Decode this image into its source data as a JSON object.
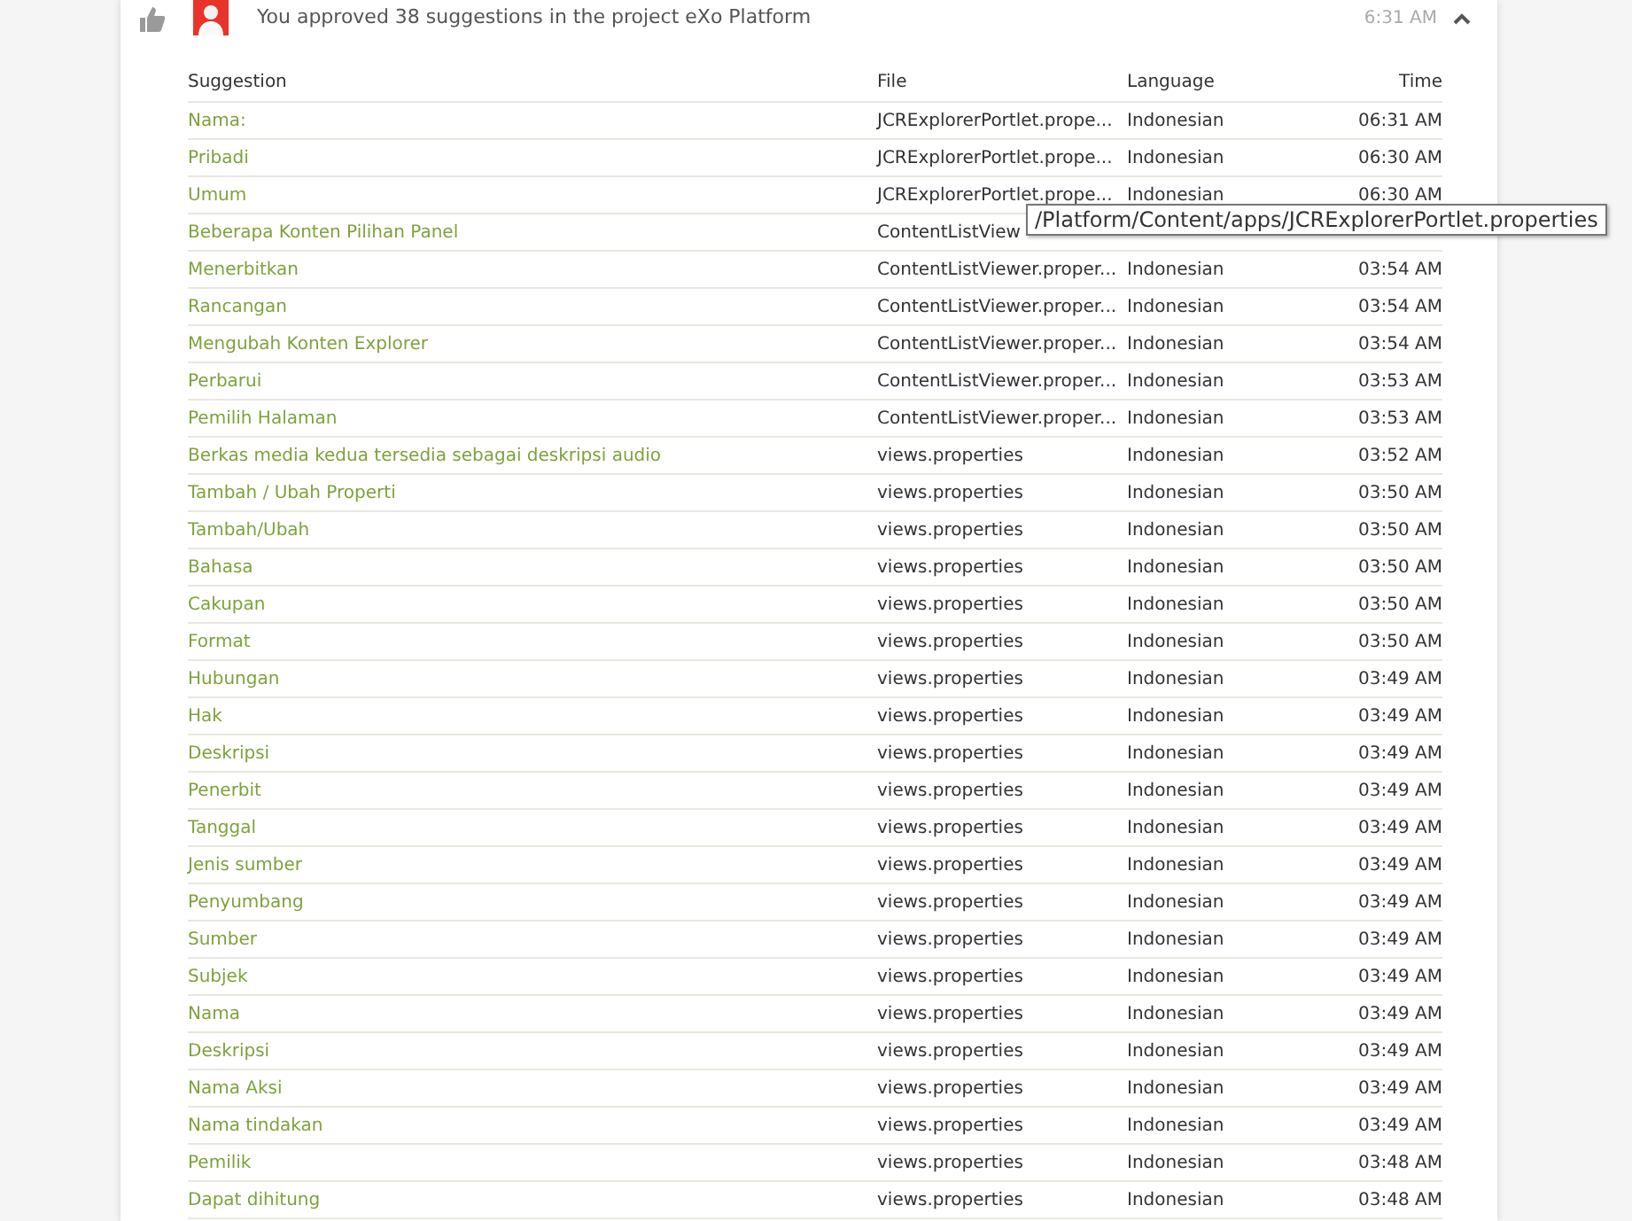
{
  "activity": {
    "message": "You approved 38 suggestions in the project eXo Platform",
    "time": "6:31 AM",
    "expanded": true
  },
  "table": {
    "columns": [
      "Suggestion",
      "File",
      "Language",
      "Time"
    ],
    "rows": [
      {
        "suggestion": "Nama:",
        "file": "JCRExplorerPortlet.prope...",
        "language": "Indonesian",
        "time": "06:31 AM"
      },
      {
        "suggestion": "Pribadi",
        "file": "JCRExplorerPortlet.prope...",
        "language": "Indonesian",
        "time": "06:30 AM"
      },
      {
        "suggestion": "Umum",
        "file": "JCRExplorerPortlet.prope...",
        "language": "Indonesian",
        "time": "06:30 AM"
      },
      {
        "suggestion": "Beberapa Konten Pilihan Panel",
        "file": "ContentListView"
      },
      {
        "suggestion": "Menerbitkan",
        "file": "ContentListViewer.proper...",
        "language": "Indonesian",
        "time": "03:54 AM"
      },
      {
        "suggestion": "Rancangan",
        "file": "ContentListViewer.proper...",
        "language": "Indonesian",
        "time": "03:54 AM"
      },
      {
        "suggestion": "Mengubah Konten Explorer",
        "file": "ContentListViewer.proper...",
        "language": "Indonesian",
        "time": "03:54 AM"
      },
      {
        "suggestion": "Perbarui",
        "file": "ContentListViewer.proper...",
        "language": "Indonesian",
        "time": "03:53 AM"
      },
      {
        "suggestion": "Pemilih Halaman",
        "file": "ContentListViewer.proper...",
        "language": "Indonesian",
        "time": "03:53 AM"
      },
      {
        "suggestion": "Berkas media kedua tersedia sebagai deskripsi audio",
        "file": "views.properties",
        "language": "Indonesian",
        "time": "03:52 AM"
      },
      {
        "suggestion": "Tambah / Ubah Properti",
        "file": "views.properties",
        "language": "Indonesian",
        "time": "03:50 AM"
      },
      {
        "suggestion": "Tambah/Ubah",
        "file": "views.properties",
        "language": "Indonesian",
        "time": "03:50 AM"
      },
      {
        "suggestion": "Bahasa",
        "file": "views.properties",
        "language": "Indonesian",
        "time": "03:50 AM"
      },
      {
        "suggestion": "Cakupan",
        "file": "views.properties",
        "language": "Indonesian",
        "time": "03:50 AM"
      },
      {
        "suggestion": "Format",
        "file": "views.properties",
        "language": "Indonesian",
        "time": "03:50 AM"
      },
      {
        "suggestion": "Hubungan",
        "file": "views.properties",
        "language": "Indonesian",
        "time": "03:49 AM"
      },
      {
        "suggestion": "Hak",
        "file": "views.properties",
        "language": "Indonesian",
        "time": "03:49 AM"
      },
      {
        "suggestion": "Deskripsi",
        "file": "views.properties",
        "language": "Indonesian",
        "time": "03:49 AM"
      },
      {
        "suggestion": "Penerbit",
        "file": "views.properties",
        "language": "Indonesian",
        "time": "03:49 AM"
      },
      {
        "suggestion": "Tanggal",
        "file": "views.properties",
        "language": "Indonesian",
        "time": "03:49 AM"
      },
      {
        "suggestion": "Jenis sumber",
        "file": "views.properties",
        "language": "Indonesian",
        "time": "03:49 AM"
      },
      {
        "suggestion": "Penyumbang",
        "file": "views.properties",
        "language": "Indonesian",
        "time": "03:49 AM"
      },
      {
        "suggestion": "Sumber",
        "file": "views.properties",
        "language": "Indonesian",
        "time": "03:49 AM"
      },
      {
        "suggestion": "Subjek",
        "file": "views.properties",
        "language": "Indonesian",
        "time": "03:49 AM"
      },
      {
        "suggestion": "Nama",
        "file": "views.properties",
        "language": "Indonesian",
        "time": "03:49 AM"
      },
      {
        "suggestion": "Deskripsi",
        "file": "views.properties",
        "language": "Indonesian",
        "time": "03:49 AM"
      },
      {
        "suggestion": "Nama Aksi",
        "file": "views.properties",
        "language": "Indonesian",
        "time": "03:49 AM"
      },
      {
        "suggestion": "Nama tindakan",
        "file": "views.properties",
        "language": "Indonesian",
        "time": "03:49 AM"
      },
      {
        "suggestion": "Pemilik",
        "file": "views.properties",
        "language": "Indonesian",
        "time": "03:48 AM"
      },
      {
        "suggestion": "Dapat dihitung",
        "file": "views.properties",
        "language": "Indonesian",
        "time": "03:48 AM"
      }
    ]
  },
  "tooltip": "/Platform/Content/apps/JCRExplorerPortlet.properties"
}
